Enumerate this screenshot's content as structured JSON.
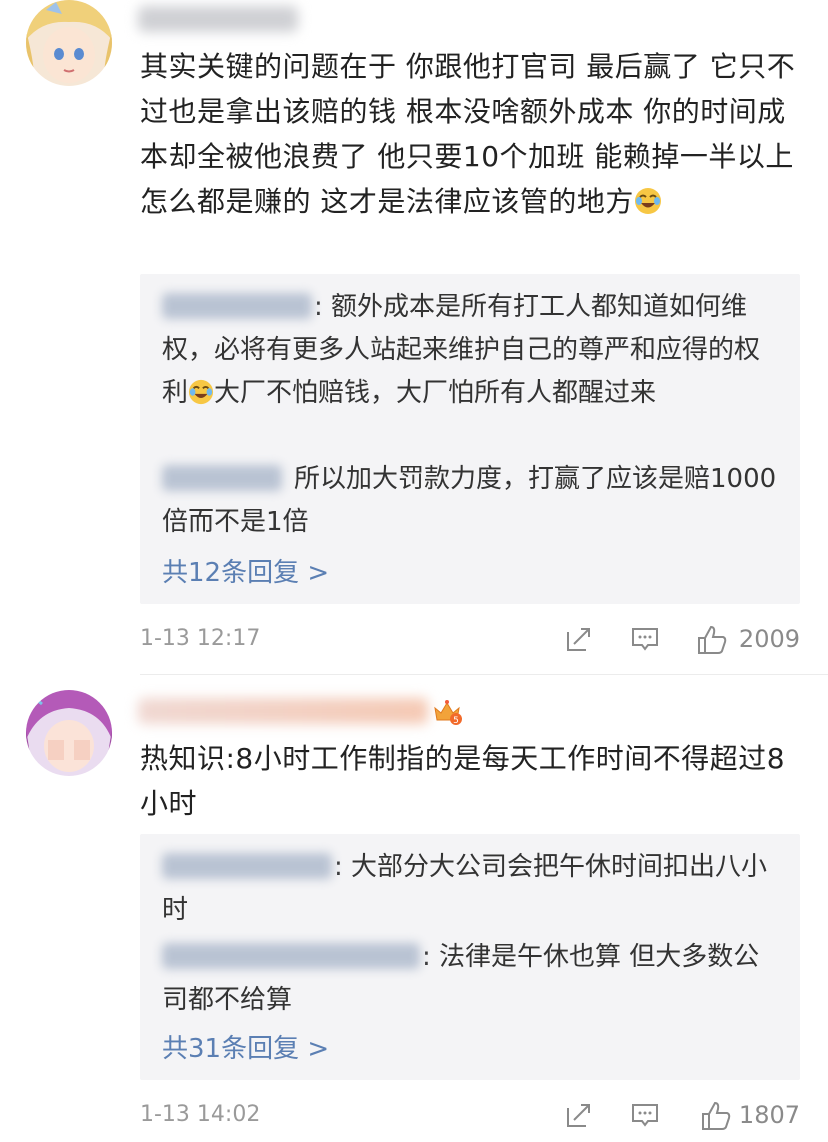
{
  "comments": [
    {
      "text_parts": [
        "其实关键的问题在于 你跟他打官司 最后赢了 它只不过也是拿出该赔的钱 根本没啥额外成本 你的时间成本却全被他浪费了 他只要10个加班 能赖掉一半以上怎么都是赚的 这才是法律应该管的地方"
      ],
      "emoji": "laugh-cry-emoji",
      "replies": [
        {
          "text_a": ": 额外成本是所有打工人都知道如何维权，必将有更多人站起来维护自己的尊严和应得的权利",
          "text_b": "大厂不怕赔钱，大厂怕所有人都醒过来"
        },
        {
          "text": "所以加大罚款力度，打赢了应该是赔1000倍而不是1倍"
        }
      ],
      "more_replies": "共12条回复 >",
      "time": "1-13 12:17",
      "likes": "2009"
    },
    {
      "text": "热知识:8小时工作制指的是每天工作时间不得超过8小时",
      "replies": [
        {
          "text": ": 大部分大公司会把午休时间扣出八小时"
        },
        {
          "text": ": 法律是午休也算 但大多数公司都不给算"
        }
      ],
      "more_replies": "共31条回复 >",
      "time": "1-13 14:02",
      "likes": "1807"
    }
  ],
  "colors": {
    "link": "#5b7fb3",
    "reply_bg": "#f4f4f6",
    "meta_text": "#9a9a9a"
  }
}
